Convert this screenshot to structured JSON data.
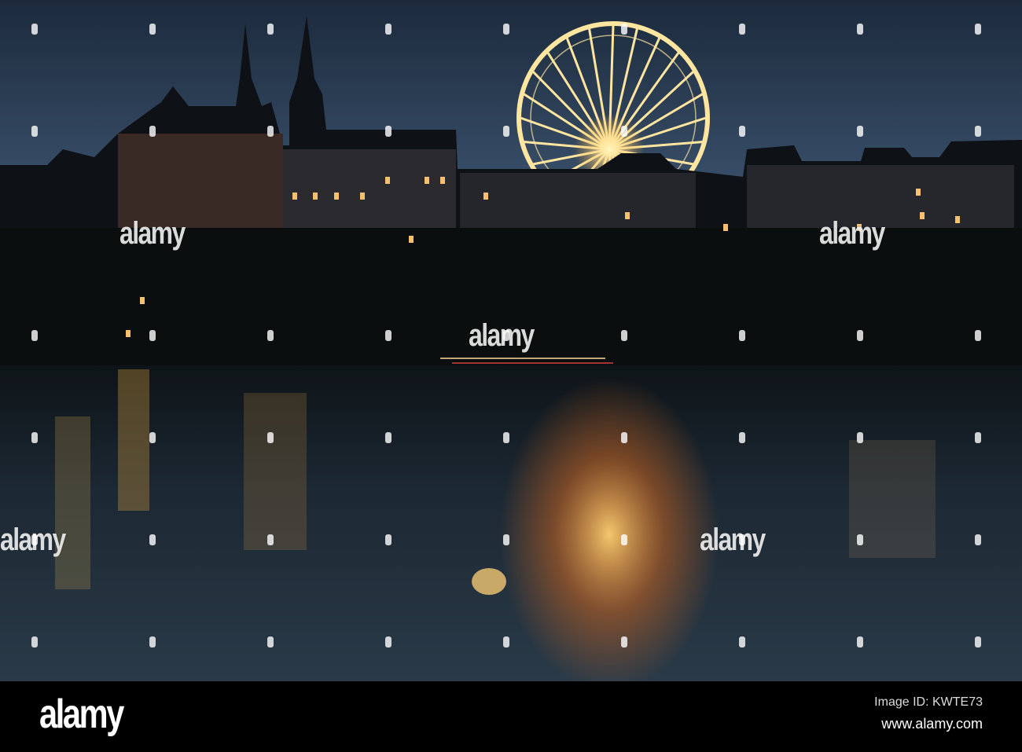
{
  "photo": {
    "subject": "night-river-city-ferris-wheel"
  },
  "watermarks": [
    "alamy",
    "alamy",
    "alamy",
    "alamy",
    "alamy",
    "alamy"
  ],
  "footer": {
    "logo": "alamy",
    "image_id": "Image ID: KWTE73",
    "site": "www.alamy.com"
  },
  "colors": {
    "sky_top": "#1c2a3c",
    "sky_low": "#58708c",
    "water": "#1a2530",
    "glow": "#ffb347"
  }
}
